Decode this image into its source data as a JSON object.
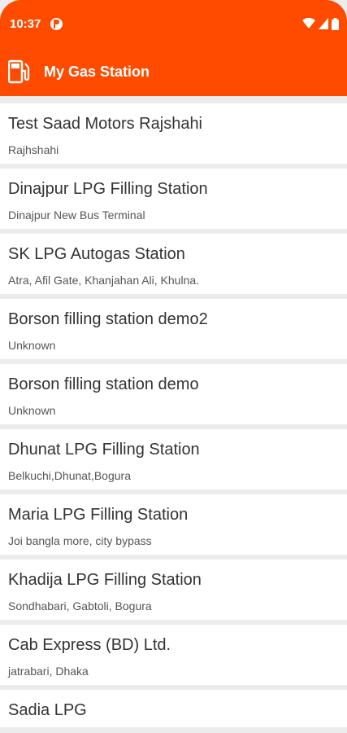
{
  "status": {
    "time": "10:37"
  },
  "app": {
    "title": "My Gas Station",
    "accent": "#ff4b00"
  },
  "stations": [
    {
      "name": "Test Saad Motors Rajshahi",
      "address": "Rajhshahi"
    },
    {
      "name": "Dinajpur LPG Filling Station",
      "address": "Dinajpur New Bus Terminal"
    },
    {
      "name": "SK LPG Autogas Station",
      "address": "Atra, Afil Gate, Khanjahan Ali, Khulna."
    },
    {
      "name": "Borson filling station demo2",
      "address": "Unknown"
    },
    {
      "name": "Borson filling station demo",
      "address": "Unknown"
    },
    {
      "name": "Dhunat LPG Filling Station",
      "address": "Belkuchi,Dhunat,Bogura"
    },
    {
      "name": "Maria LPG Filling Station",
      "address": "Joi bangla more, city bypass"
    },
    {
      "name": "Khadija LPG Filling Station",
      "address": "Sondhabari, Gabtoli, Bogura"
    },
    {
      "name": "Cab Express (BD) Ltd.",
      "address": "jatrabari, Dhaka"
    },
    {
      "name": "Sadia LPG"
    }
  ]
}
